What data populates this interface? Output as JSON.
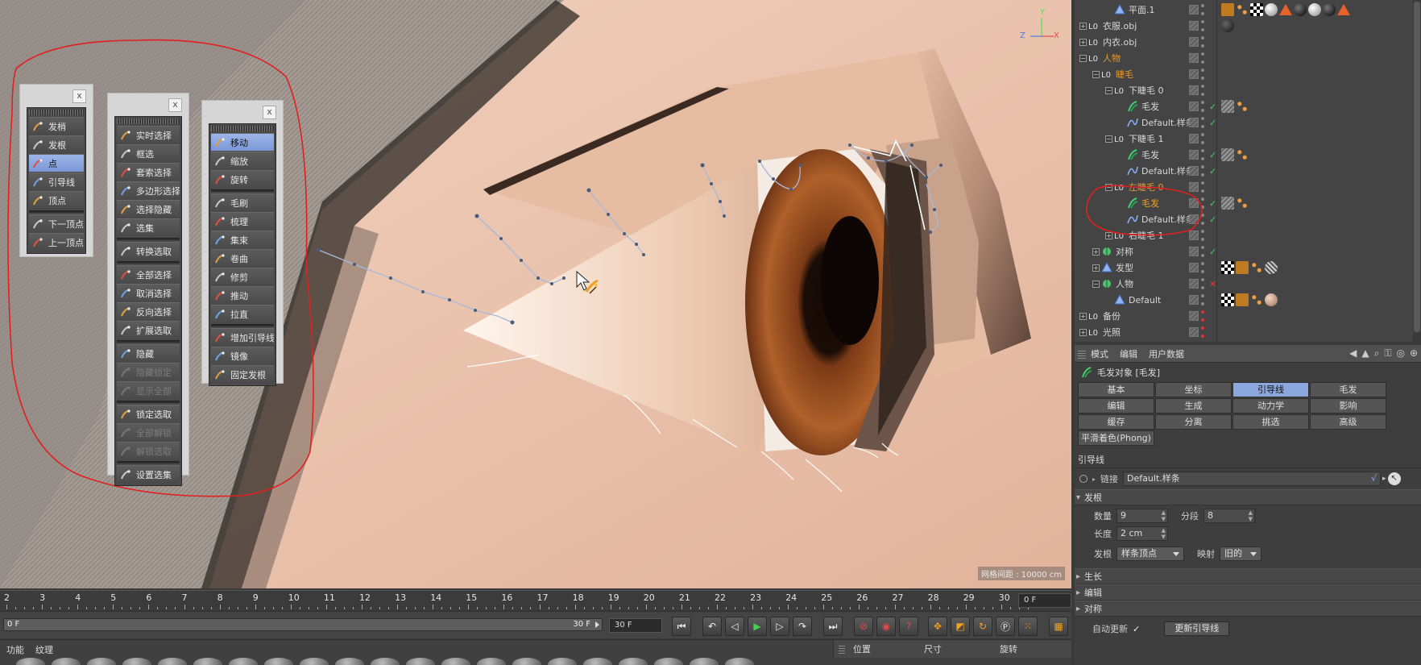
{
  "viewport": {
    "grid_info": "网格间距 : 10000 cm",
    "axes": {
      "y": "Y",
      "z": "Z",
      "x": "X"
    }
  },
  "palettes": [
    {
      "close": "x",
      "groups": [
        [
          {
            "label": "发梢",
            "icon": "hair-tip-icon",
            "state": "normal"
          },
          {
            "label": "发根",
            "icon": "hair-root-icon",
            "state": "normal"
          },
          {
            "label": "点",
            "icon": "point-icon",
            "state": "active"
          },
          {
            "label": "引导线",
            "icon": "guide-icon",
            "state": "normal"
          },
          {
            "label": "顶点",
            "icon": "vertex-icon",
            "state": "normal"
          }
        ],
        [
          {
            "label": "下一顶点",
            "icon": "next-vertex-icon",
            "state": "normal"
          },
          {
            "label": "上一顶点",
            "icon": "prev-vertex-icon",
            "state": "normal"
          }
        ]
      ]
    },
    {
      "close": "x",
      "groups": [
        [
          {
            "label": "实时选择",
            "icon": "live-select-icon",
            "state": "normal"
          },
          {
            "label": "框选",
            "icon": "box-select-icon",
            "state": "normal"
          },
          {
            "label": "套索选择",
            "icon": "lasso-select-icon",
            "state": "normal"
          },
          {
            "label": "多边形选择",
            "icon": "polygon-select-icon",
            "state": "normal"
          },
          {
            "label": "选择隐藏",
            "icon": "select-hidden-icon",
            "state": "normal"
          },
          {
            "label": "选集",
            "icon": "selection-set-icon",
            "state": "normal"
          }
        ],
        [
          {
            "label": "转换选取",
            "icon": "convert-selection-icon",
            "state": "normal"
          }
        ],
        [
          {
            "label": "全部选择",
            "icon": "select-all-icon",
            "state": "normal"
          },
          {
            "label": "取消选择",
            "icon": "deselect-icon",
            "state": "normal"
          },
          {
            "label": "反向选择",
            "icon": "invert-selection-icon",
            "state": "normal"
          },
          {
            "label": "扩展选取",
            "icon": "grow-selection-icon",
            "state": "normal"
          }
        ],
        [
          {
            "label": "隐藏",
            "icon": "hide-icon",
            "state": "normal"
          },
          {
            "label": "隐藏锁定",
            "icon": "hide-lock-icon",
            "state": "disabled"
          },
          {
            "label": "显示全部",
            "icon": "show-all-icon",
            "state": "disabled"
          }
        ],
        [
          {
            "label": "锁定选取",
            "icon": "lock-selection-icon",
            "state": "normal"
          },
          {
            "label": "全部解锁",
            "icon": "unlock-all-icon",
            "state": "disabled"
          },
          {
            "label": "解锁选取",
            "icon": "unlock-selection-icon",
            "state": "disabled"
          }
        ],
        [
          {
            "label": "设置选集",
            "icon": "set-selection-icon",
            "state": "normal"
          }
        ]
      ]
    },
    {
      "close": "x",
      "groups": [
        [
          {
            "label": "移动",
            "icon": "move-icon",
            "state": "active"
          },
          {
            "label": "缩放",
            "icon": "scale-icon",
            "state": "normal"
          },
          {
            "label": "旋转",
            "icon": "rotate-icon",
            "state": "normal"
          }
        ],
        [
          {
            "label": "毛刷",
            "icon": "brush-icon",
            "state": "normal"
          },
          {
            "label": "梳理",
            "icon": "comb-icon",
            "state": "normal"
          },
          {
            "label": "集束",
            "icon": "clump-icon",
            "state": "normal"
          },
          {
            "label": "卷曲",
            "icon": "curl-icon",
            "state": "normal"
          },
          {
            "label": "修剪",
            "icon": "cut-icon",
            "state": "normal"
          },
          {
            "label": "推动",
            "icon": "push-icon",
            "state": "normal"
          },
          {
            "label": "拉直",
            "icon": "straighten-icon",
            "state": "normal"
          }
        ],
        [
          {
            "label": "增加引导线",
            "icon": "add-guide-icon",
            "state": "normal"
          },
          {
            "label": "镜像",
            "icon": "mirror-icon",
            "state": "normal"
          },
          {
            "label": "固定发根",
            "icon": "fix-root-icon",
            "state": "normal"
          }
        ]
      ]
    }
  ],
  "object_manager": {
    "rows": [
      {
        "name": "平面.1",
        "depth": 2,
        "expander": "",
        "icon": "plane-icon",
        "style": "",
        "check": "",
        "tags": [
          "orange-tag",
          "dots-tag",
          "checker-tag",
          "white-ball",
          "orange-triangle",
          "black-ball",
          "white-ball",
          "black-ball",
          "orange-triangle"
        ]
      },
      {
        "name": "衣服.obj",
        "depth": 0,
        "expander": "+",
        "icon": "null-icon",
        "style": "",
        "check": "",
        "tags": [
          "dark-ball"
        ]
      },
      {
        "name": "内衣.obj",
        "depth": 0,
        "expander": "+",
        "icon": "null-icon",
        "style": "",
        "check": "",
        "tags": []
      },
      {
        "name": "人物",
        "depth": 0,
        "expander": "−",
        "icon": "null-icon",
        "style": "orange",
        "check": "",
        "tags": []
      },
      {
        "name": "睫毛",
        "depth": 1,
        "expander": "−",
        "icon": "null-icon",
        "style": "orange",
        "check": "",
        "tags": []
      },
      {
        "name": "下睫毛 0",
        "depth": 2,
        "expander": "−",
        "icon": "null-icon",
        "style": "",
        "check": "",
        "tags": []
      },
      {
        "name": "毛发",
        "depth": 3,
        "expander": "",
        "icon": "hair-icon",
        "style": "",
        "check": "✓",
        "tags": [
          "hair-tag",
          "dots-tag"
        ]
      },
      {
        "name": "Default.样条",
        "depth": 3,
        "expander": "",
        "icon": "spline-icon",
        "style": "",
        "check": "✓",
        "tags": []
      },
      {
        "name": "下睫毛 1",
        "depth": 2,
        "expander": "−",
        "icon": "null-icon",
        "style": "",
        "check": "",
        "tags": []
      },
      {
        "name": "毛发",
        "depth": 3,
        "expander": "",
        "icon": "hair-icon",
        "style": "",
        "check": "✓",
        "tags": [
          "hair-tag",
          "dots-tag"
        ]
      },
      {
        "name": "Default.样条",
        "depth": 3,
        "expander": "",
        "icon": "spline-icon",
        "style": "",
        "check": "✓",
        "tags": []
      },
      {
        "name": "左睫毛 0",
        "depth": 2,
        "expander": "−",
        "icon": "null-icon",
        "style": "orange",
        "check": "",
        "tags": []
      },
      {
        "name": "毛发",
        "depth": 3,
        "expander": "",
        "icon": "hair-icon",
        "style": "highlight",
        "check": "✓",
        "tags": [
          "hair-tag",
          "dots-tag"
        ]
      },
      {
        "name": "Default.样条",
        "depth": 3,
        "expander": "",
        "icon": "spline-icon",
        "style": "",
        "check": "✓",
        "tags": []
      },
      {
        "name": "右睫毛 1",
        "depth": 2,
        "expander": "+",
        "icon": "null-icon",
        "style": "",
        "check": "",
        "tags": []
      },
      {
        "name": "对称",
        "depth": 1,
        "expander": "+",
        "icon": "symmetry-icon",
        "style": "",
        "check": "✓",
        "tags": []
      },
      {
        "name": "发型",
        "depth": 1,
        "expander": "+",
        "icon": "plane-icon",
        "style": "",
        "check": "",
        "tags": [
          "checker-tag",
          "orange-tag",
          "dots-tag",
          "stripe-tag"
        ]
      },
      {
        "name": "人物",
        "depth": 1,
        "expander": "−",
        "icon": "symmetry-icon",
        "style": "",
        "check": "✕",
        "tags": []
      },
      {
        "name": "Default",
        "depth": 2,
        "expander": "",
        "icon": "plane-icon",
        "style": "",
        "check": "",
        "tags": [
          "checker-tag",
          "orange-tag",
          "dots-tag",
          "skin-ball"
        ]
      },
      {
        "name": "备份",
        "depth": 0,
        "expander": "+",
        "icon": "null-icon",
        "style": "",
        "check": "",
        "tags": []
      },
      {
        "name": "光照",
        "depth": 0,
        "expander": "+",
        "icon": "null-icon",
        "style": "",
        "check": "",
        "tags": []
      }
    ]
  },
  "attribute_manager": {
    "menu": [
      "模式",
      "编辑",
      "用户数据"
    ],
    "title": "毛发对象 [毛发]",
    "tabs": [
      "基本",
      "坐标",
      "引导线",
      "毛发",
      "编辑",
      "生成",
      "动力学",
      "影响",
      "缓存",
      "分离",
      "挑选",
      "高级",
      "平滑着色(Phong)"
    ],
    "active_tab": "引导线",
    "section": "引导线",
    "link_label": "链接",
    "link_value": "Default.样条",
    "root_group": "发根",
    "count_label": "数量",
    "count_value": "9",
    "segments_label": "分段",
    "segments_value": "8",
    "length_label": "长度",
    "length_value": "2 cm",
    "root_label": "发根",
    "root_value": "样条顶点",
    "mapping_label": "映射",
    "mapping_value": "旧的",
    "collapsed": [
      "生长",
      "编辑",
      "对称"
    ],
    "auto_update_label": "自动更新",
    "auto_update_check": "✓",
    "update_button": "更新引导线"
  },
  "timeline": {
    "ticks": [
      "2",
      "3",
      "4",
      "5",
      "6",
      "7",
      "8",
      "9",
      "10",
      "11",
      "12",
      "13",
      "14",
      "15",
      "16",
      "17",
      "18",
      "19",
      "20",
      "21",
      "22",
      "23",
      "24",
      "25",
      "26",
      "27",
      "28",
      "29",
      "30"
    ],
    "current_frame": "0 F",
    "range_start": "0 F",
    "range_end_in_bar": "30 F",
    "range_end": "30 F"
  },
  "bottom": {
    "menu": [
      "功能",
      "纹理"
    ],
    "coord_headers": [
      "位置",
      "尺寸",
      "旋转"
    ]
  },
  "colors": {
    "active_blue": "#8ca6de",
    "orange_name": "#e89a2a",
    "annotation_red": "#e02020",
    "check_green": "#3fd34f"
  }
}
